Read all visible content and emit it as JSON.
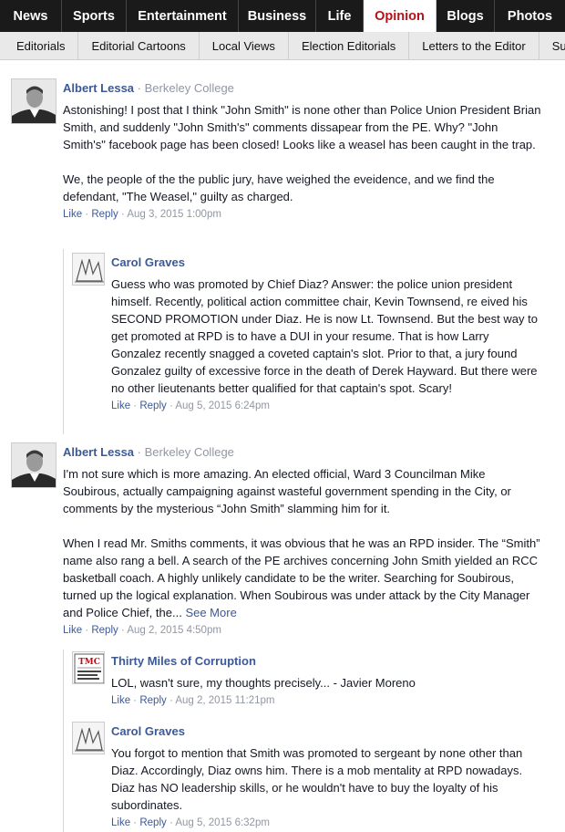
{
  "nav": {
    "items": [
      "News",
      "Sports",
      "Entertainment",
      "Business",
      "Life",
      "Opinion",
      "Blogs",
      "Photos"
    ],
    "active": "Opinion"
  },
  "subnav": {
    "items": [
      "Editorials",
      "Editorial Cartoons",
      "Local Views",
      "Election Editorials",
      "Letters to the Editor",
      "Submit"
    ]
  },
  "comments": [
    {
      "author": "Albert Lessa",
      "affiliation": "Berkeley College",
      "paragraphs": [
        "Astonishing! I post that I think \"John Smith\" is none other than Police Union President Brian Smith, and suddenly \"John Smith's\" comments dissapear from the PE. Why? \"John Smith's\" facebook page has been closed! Looks like a weasel has been caught in the trap.",
        "We, the people of the the public jury, have weighed the eveidence, and we find the defendant, \"The Weasel,\" guilty as charged."
      ],
      "like": "Like",
      "reply": "Reply",
      "date": "Aug 3, 2015 1:00pm",
      "replies": [
        {
          "author": "Carol Graves",
          "paragraphs": [
            "Guess who was promoted by Chief Diaz? Answer: the police union president himself. Recently, political action committee chair, Kevin Townsend, re eived his SECOND PROMOTION under Diaz. He is now Lt. Townsend. But the best way to get promoted at RPD is to have a DUI in your resume. That is how Larry Gonzalez recently snagged a coveted captain's slot. Prior to that, a jury found Gonzalez guilty of excessive force in the death of Derek Hayward. But there were no other lieutenants better qualified for that captain's spot. Scary!"
          ],
          "like": "Like",
          "reply": "Reply",
          "date": "Aug 5, 2015 6:24pm"
        }
      ]
    },
    {
      "author": "Albert Lessa",
      "affiliation": "Berkeley College",
      "paragraphs": [
        "I'm not sure which is more amazing. An elected official, Ward 3 Councilman Mike Soubirous, actually campaigning against wasteful government spending in the City, or comments by the mysterious “John Smith” slamming him for it.",
        "When I read Mr. Smiths comments, it was obvious that he was an RPD insider. The “Smith” name also rang a bell. A search of the PE archives concerning John Smith yielded an RCC basketball coach. A highly unlikely candidate to be the writer. Searching for Soubirous, turned up the logical explanation. When Soubirous was under attack by the City Manager and Police Chief, the..."
      ],
      "see_more": "See More",
      "like": "Like",
      "reply": "Reply",
      "date": "Aug 2, 2015 4:50pm",
      "replies": [
        {
          "author": "Thirty Miles of Corruption",
          "avatar_text": "TMC",
          "avatar_sub": "THIRTY MILES OF CORRUPTION",
          "paragraphs": [
            "LOL, wasn't sure, my thoughts precisely... - Javier Moreno"
          ],
          "like": "Like",
          "reply": "Reply",
          "date": "Aug 2, 2015 11:21pm"
        },
        {
          "author": "Carol Graves",
          "paragraphs": [
            "You forgot to mention that Smith was promoted to sergeant by none other than Diaz. Accordingly, Diaz owns him. There is a mob mentality at RPD nowadays. Diaz has NO leadership skills, or he wouldn't have to buy the loyalty of his subordinates."
          ],
          "like": "Like",
          "reply": "Reply",
          "date": "Aug 5, 2015 6:32pm"
        }
      ]
    }
  ]
}
